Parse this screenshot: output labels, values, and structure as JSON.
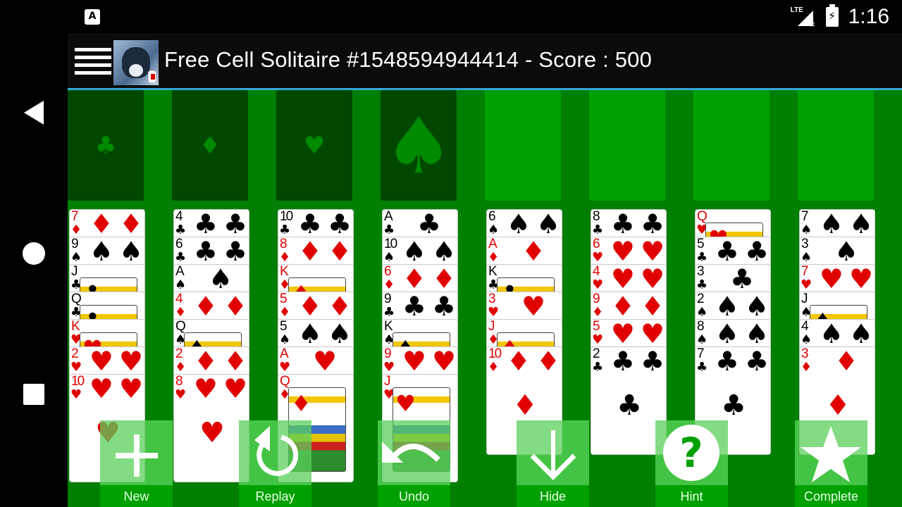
{
  "status_bar": {
    "app_icon": "A",
    "network": "LTE",
    "battery_icon": "battery-charging-icon",
    "time": "1:16"
  },
  "nav_bar": {
    "back_icon": "back-triangle-icon",
    "home_icon": "home-circle-icon",
    "recents_icon": "recents-square-icon"
  },
  "header": {
    "menu_icon": "hamburger-menu-icon",
    "logo_icon": "cat-logo-icon",
    "title": "Free Cell Solitaire #1548594944414 - Score : 500"
  },
  "foundations": [
    {
      "suit": "clubs",
      "glyph": "♣",
      "size": "small"
    },
    {
      "suit": "diamonds",
      "glyph": "♦",
      "size": "small"
    },
    {
      "suit": "hearts",
      "glyph": "♥",
      "size": "small"
    },
    {
      "suit": "spades",
      "glyph": "♠",
      "size": "large"
    }
  ],
  "free_cells": [
    {
      "card": null
    },
    {
      "card": null
    },
    {
      "card": null
    },
    {
      "card": null
    }
  ],
  "colors": {
    "table": "#007f00",
    "foundation": "#004800",
    "free_cell": "#00a000",
    "accent_line": "#33a8d8",
    "red_suit": "#e00000"
  },
  "columns": [
    [
      {
        "rank": "7",
        "suit": "♦",
        "color": "red"
      },
      {
        "rank": "9",
        "suit": "♠",
        "color": "black"
      },
      {
        "rank": "J",
        "suit": "♣",
        "color": "black",
        "face": true
      },
      {
        "rank": "Q",
        "suit": "♣",
        "color": "black",
        "face": true
      },
      {
        "rank": "K",
        "suit": "♥",
        "color": "red",
        "face": true
      },
      {
        "rank": "2",
        "suit": "♥",
        "color": "red"
      },
      {
        "rank": "10",
        "suit": "♥",
        "color": "red"
      }
    ],
    [
      {
        "rank": "4",
        "suit": "♣",
        "color": "black"
      },
      {
        "rank": "6",
        "suit": "♣",
        "color": "black"
      },
      {
        "rank": "A",
        "suit": "♠",
        "color": "black"
      },
      {
        "rank": "4",
        "suit": "♦",
        "color": "red"
      },
      {
        "rank": "Q",
        "suit": "♠",
        "color": "black",
        "face": true
      },
      {
        "rank": "2",
        "suit": "♦",
        "color": "red"
      },
      {
        "rank": "8",
        "suit": "♥",
        "color": "red"
      }
    ],
    [
      {
        "rank": "10",
        "suit": "♣",
        "color": "black"
      },
      {
        "rank": "8",
        "suit": "♦",
        "color": "red"
      },
      {
        "rank": "K",
        "suit": "♦",
        "color": "red",
        "face": true
      },
      {
        "rank": "5",
        "suit": "♦",
        "color": "red"
      },
      {
        "rank": "5",
        "suit": "♠",
        "color": "black"
      },
      {
        "rank": "A",
        "suit": "♥",
        "color": "red"
      },
      {
        "rank": "Q",
        "suit": "♦",
        "color": "red",
        "face": true
      }
    ],
    [
      {
        "rank": "A",
        "suit": "♣",
        "color": "black"
      },
      {
        "rank": "10",
        "suit": "♠",
        "color": "black"
      },
      {
        "rank": "6",
        "suit": "♦",
        "color": "red"
      },
      {
        "rank": "9",
        "suit": "♣",
        "color": "black"
      },
      {
        "rank": "K",
        "suit": "♠",
        "color": "black",
        "face": true
      },
      {
        "rank": "9",
        "suit": "♥",
        "color": "red"
      },
      {
        "rank": "J",
        "suit": "♥",
        "color": "red",
        "face": true
      }
    ],
    [
      {
        "rank": "6",
        "suit": "♠",
        "color": "black"
      },
      {
        "rank": "A",
        "suit": "♦",
        "color": "red"
      },
      {
        "rank": "K",
        "suit": "♣",
        "color": "black",
        "face": true
      },
      {
        "rank": "3",
        "suit": "♥",
        "color": "red"
      },
      {
        "rank": "J",
        "suit": "♦",
        "color": "red",
        "face": true
      },
      {
        "rank": "10",
        "suit": "♦",
        "color": "red"
      }
    ],
    [
      {
        "rank": "8",
        "suit": "♣",
        "color": "black"
      },
      {
        "rank": "6",
        "suit": "♥",
        "color": "red"
      },
      {
        "rank": "4",
        "suit": "♥",
        "color": "red"
      },
      {
        "rank": "9",
        "suit": "♦",
        "color": "red"
      },
      {
        "rank": "5",
        "suit": "♥",
        "color": "red"
      },
      {
        "rank": "2",
        "suit": "♣",
        "color": "black"
      }
    ],
    [
      {
        "rank": "Q",
        "suit": "♥",
        "color": "red",
        "face": true
      },
      {
        "rank": "5",
        "suit": "♣",
        "color": "black"
      },
      {
        "rank": "3",
        "suit": "♣",
        "color": "black"
      },
      {
        "rank": "2",
        "suit": "♠",
        "color": "black"
      },
      {
        "rank": "8",
        "suit": "♠",
        "color": "black"
      },
      {
        "rank": "7",
        "suit": "♣",
        "color": "black"
      }
    ],
    [
      {
        "rank": "7",
        "suit": "♠",
        "color": "black"
      },
      {
        "rank": "3",
        "suit": "♠",
        "color": "black"
      },
      {
        "rank": "7",
        "suit": "♥",
        "color": "red"
      },
      {
        "rank": "J",
        "suit": "♠",
        "color": "black",
        "face": true
      },
      {
        "rank": "4",
        "suit": "♠",
        "color": "black"
      },
      {
        "rank": "3",
        "suit": "♦",
        "color": "red"
      }
    ]
  ],
  "toolbar": [
    {
      "label": "New",
      "icon": "plus-icon"
    },
    {
      "label": "Replay",
      "icon": "replay-icon"
    },
    {
      "label": "Undo",
      "icon": "undo-icon"
    },
    {
      "label": "Hide",
      "icon": "arrow-down-icon"
    },
    {
      "label": "Hint",
      "icon": "help-circle-icon"
    },
    {
      "label": "Complete",
      "icon": "star-icon"
    }
  ]
}
